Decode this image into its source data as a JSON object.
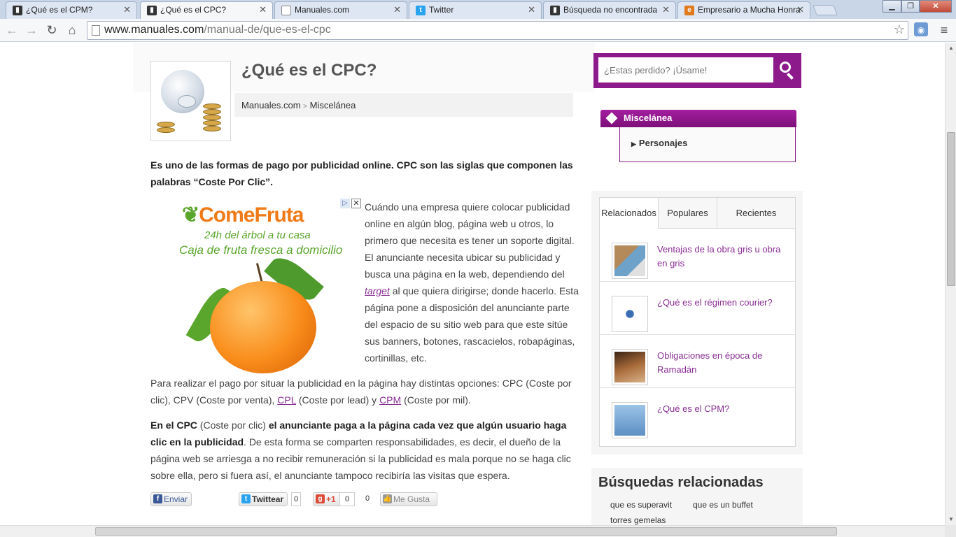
{
  "browser": {
    "tabs": [
      {
        "title": "¿Qué es el CPM?",
        "icon": "manuales-favicon",
        "active": false
      },
      {
        "title": "¿Qué es el CPC?",
        "icon": "manuales-favicon",
        "active": true
      },
      {
        "title": "Manuales.com",
        "icon": "blank-page-favicon",
        "active": false
      },
      {
        "title": "Twitter",
        "icon": "twitter-bird-favicon",
        "active": false
      },
      {
        "title": "Búsqueda no encontrada",
        "icon": "manuales-favicon",
        "active": false
      },
      {
        "title": "Empresario a Mucha Honra",
        "icon": "blog-favicon",
        "active": false
      }
    ],
    "url_domain": "www.manuales.com",
    "url_path": "/manual-de/que-es-el-cpc"
  },
  "article": {
    "title": "¿Qué es el CPC?",
    "breadcrumb": {
      "home": "Manuales.com",
      "separator": ">",
      "section": "Miscelánea"
    },
    "lead": "Es uno de las formas de pago por publicidad online. CPC son las siglas que componen las palabras “Coste Por Clic”.",
    "para1": {
      "before": "Cuándo una empresa quiere colocar publicidad online en algún blog, página web u otros, lo primero que necesita es tener un soporte digital. El anunciante necesita ubicar su publicidad y busca una página en la web, dependiendo del ",
      "link": "target",
      "after": " al que quiera dirigirse; donde hacerlo. Esta página pone a disposición del anunciante parte del espacio de su sitio web para que este sitúe sus banners, botones, rascacielos, robapáginas, cortinillas, etc."
    },
    "para2": {
      "before": "Para realizar el pago por situar la publicidad en la página hay distintas opciones: CPC (Coste por clic), CPV (Coste por venta), ",
      "link1": "CPL",
      "middle": " (Coste por lead) y ",
      "link2": "CPM",
      "after": " (Coste por mil)."
    },
    "para3": {
      "b1": "En el CPC",
      "t1": " (Coste por clic) ",
      "b2": "el anunciante paga a la página cada vez que algún usuario haga clic en la publicidad",
      "t2": ". De esta forma se comparten responsabilidades, es decir, el dueño de la página web se arriesga a no recibir remuneración si la publicidad es mala porque no se haga clic sobre ella, pero si fuera así, el anunciante tampoco recibiría las visitas que espera."
    }
  },
  "ad": {
    "brand": "ComeFruta",
    "tagline1": "24h del árbol a tu casa",
    "tagline2": "Caja de fruta fresca a domicilio"
  },
  "share": {
    "facebook": "Enviar",
    "twitter": "Twittear",
    "twitter_count": "0",
    "gplus": "+1",
    "gplus_count": "0",
    "like_count": "0",
    "like": "Me Gusta"
  },
  "sidebar": {
    "search_placeholder": "¿Estas perdido? ¡Úsame!",
    "category_title": "Miscelánea",
    "category_item": "Personajes",
    "tabs": [
      "Relacionados",
      "Populares",
      "Recientes"
    ],
    "related": [
      {
        "title": "Ventajas de la obra gris u obra en gris",
        "icon": "house-icon"
      },
      {
        "title": "¿Qué es el régimen courier?",
        "icon": "network-icon"
      },
      {
        "title": "Obligaciones en época de Ramadán",
        "icon": "book-icon"
      },
      {
        "title": "¿Qué es el CPM?",
        "icon": "people-icon"
      }
    ],
    "related_searches_title": "Búsquedas relacionadas",
    "related_searches": [
      "que es superavit",
      "que es un buffet",
      "torres gemelas"
    ]
  },
  "colors": {
    "accent": "#8d1a8a",
    "link": "#8a2e95"
  }
}
